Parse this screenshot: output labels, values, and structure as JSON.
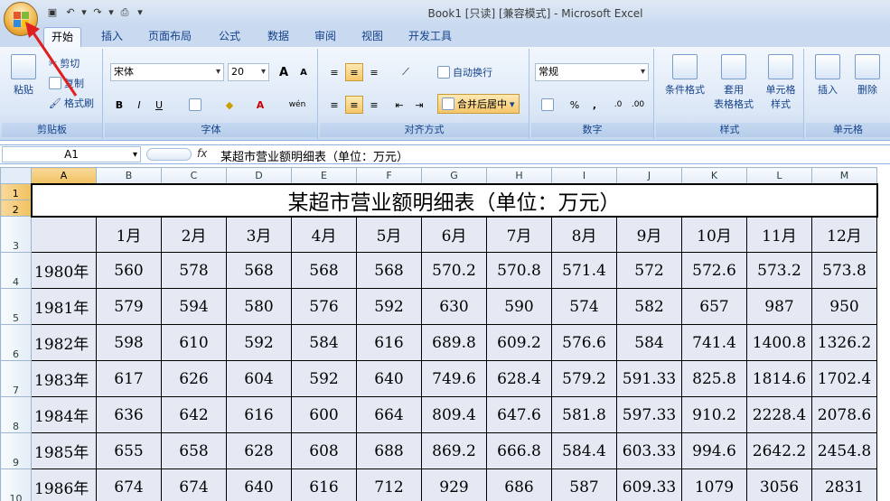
{
  "window": {
    "title": "Book1  [只读]  [兼容模式] - Microsoft Excel"
  },
  "ribbon_tabs": [
    "开始",
    "插入",
    "页面布局",
    "公式",
    "数据",
    "审阅",
    "视图",
    "开发工具"
  ],
  "clipboard": {
    "paste": "粘贴",
    "cut": "剪切",
    "copy": "复制",
    "format_painter": "格式刷",
    "label": "剪贴板"
  },
  "font": {
    "name": "宋体",
    "size": "20",
    "bold": "B",
    "italic": "I",
    "underline": "U",
    "grow": "A",
    "shrink": "A",
    "phonetic": "wén",
    "label": "字体"
  },
  "alignment": {
    "wrap": "自动换行",
    "merge": "合并后居中",
    "label": "对齐方式"
  },
  "number": {
    "format": "常规",
    "percent": "%",
    "comma": ",",
    "label": "数字"
  },
  "styles": {
    "conditional": "条件格式",
    "table_l1": "套用",
    "table_l2": "表格格式",
    "cell_l1": "单元格",
    "cell_l2": "样式",
    "label": "样式"
  },
  "cells": {
    "insert": "插入",
    "delete": "删除",
    "label": "单元格"
  },
  "formula_bar": {
    "name_box": "A1",
    "fx": "fx",
    "content": "某超市营业额明细表（单位：万元）"
  },
  "sheet": {
    "columns": [
      "A",
      "B",
      "C",
      "D",
      "E",
      "F",
      "G",
      "H",
      "I",
      "J",
      "K",
      "L",
      "M"
    ],
    "title": "某超市营业额明细表（单位：万元）",
    "months": [
      "1月",
      "2月",
      "3月",
      "4月",
      "5月",
      "6月",
      "7月",
      "8月",
      "9月",
      "10月",
      "11月",
      "12月"
    ],
    "rows": [
      {
        "year": "1980年",
        "values": [
          "560",
          "578",
          "568",
          "568",
          "568",
          "570.2",
          "570.8",
          "571.4",
          "572",
          "572.6",
          "573.2",
          "573.8"
        ]
      },
      {
        "year": "1981年",
        "values": [
          "579",
          "594",
          "580",
          "576",
          "592",
          "630",
          "590",
          "574",
          "582",
          "657",
          "987",
          "950"
        ]
      },
      {
        "year": "1982年",
        "values": [
          "598",
          "610",
          "592",
          "584",
          "616",
          "689.8",
          "609.2",
          "576.6",
          "584",
          "741.4",
          "1400.8",
          "1326.2"
        ]
      },
      {
        "year": "1983年",
        "values": [
          "617",
          "626",
          "604",
          "592",
          "640",
          "749.6",
          "628.4",
          "579.2",
          "591.33",
          "825.8",
          "1814.6",
          "1702.4"
        ]
      },
      {
        "year": "1984年",
        "values": [
          "636",
          "642",
          "616",
          "600",
          "664",
          "809.4",
          "647.6",
          "581.8",
          "597.33",
          "910.2",
          "2228.4",
          "2078.6"
        ]
      },
      {
        "year": "1985年",
        "values": [
          "655",
          "658",
          "628",
          "608",
          "688",
          "869.2",
          "666.8",
          "584.4",
          "603.33",
          "994.6",
          "2642.2",
          "2454.8"
        ]
      },
      {
        "year": "1986年",
        "values": [
          "674",
          "674",
          "640",
          "616",
          "712",
          "929",
          "686",
          "587",
          "609.33",
          "1079",
          "3056",
          "2831"
        ]
      }
    ]
  },
  "colors": {
    "ribbon": "#dbe7f6",
    "selected_header": "#f1c15f",
    "cell_fill": "#e4e9f4"
  }
}
